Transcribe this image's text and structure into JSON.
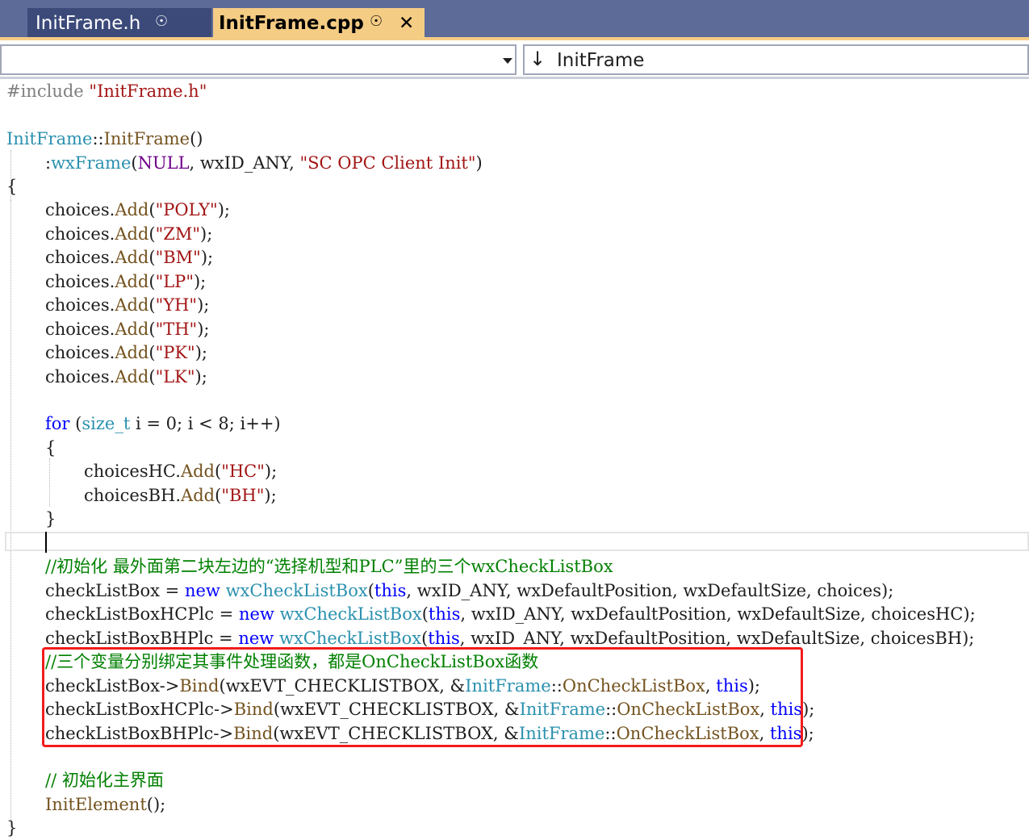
{
  "tabs": [
    {
      "label": "InitFrame.h",
      "pin": "☉"
    },
    {
      "label": "InitFrame.cpp",
      "pin": "☉",
      "close": "✕"
    }
  ],
  "icons": {
    "pin": "pin-icon",
    "close": "close-icon",
    "member": "down-arrow-icon"
  },
  "nav": {
    "member_arrow": "↓",
    "member": "InitFrame"
  },
  "code": {
    "include_kw": "#include",
    "include_file": "\"InitFrame.h\"",
    "class_name": "InitFrame",
    "scope": "::",
    "ctor_name": "InitFrame",
    "ctor_parens": "()",
    "init_colon": ":",
    "base_class": "wxFrame",
    "base_open": "(",
    "null_kw": "NULL",
    "comma": ",",
    "id_any": "wxID_ANY",
    "title_str": "\"SC OPC Client Init\"",
    "close_paren": ")",
    "open_brace": "{",
    "close_brace": "}",
    "choices_var": "choices",
    "dot": ".",
    "add_fn": "Add",
    "open_paren": "(",
    "close_semi": ");",
    "choice_values": [
      "\"POLY\"",
      "\"ZM\"",
      "\"BM\"",
      "\"LP\"",
      "\"YH\"",
      "\"TH\"",
      "\"PK\"",
      "\"LK\""
    ],
    "for_kw": "for",
    "size_t_type": "size_t",
    "for_tail": " i = 0; i < 8; i++)",
    "hc_var": "choicesHC",
    "hc_str": "\"HC\"",
    "bh_var": "choicesBH",
    "bh_str": "\"BH\"",
    "comment_init_boxes": "//初始化 最外面第二块左边的“选择机型和PLC”里的三个wxCheckListBox",
    "clb_var1": "checkListBox",
    "clb_var2": "checkListBoxHCPlc",
    "clb_var3": "checkListBoxBHPlc",
    "assign": " = ",
    "new_kw": "new",
    "clb_type": "wxCheckListBox",
    "this_kw": "this",
    "ctor_args_mid": ", wxID_ANY, wxDefaultPosition, wxDefaultSize, ",
    "args1": "choices",
    "args2": "choicesHC",
    "args3": "choicesBH",
    "comment_bind": "//三个变量分别绑定其事件处理函数，都是OnCheckListBox函数",
    "arrow": "->",
    "bind_fn": "Bind",
    "bind_args": "(wxEVT_CHECKLISTBOX, &",
    "handler": "OnCheckListBox",
    "comma_sp": ", ",
    "comment_main": "// 初始化主界面",
    "init_element": "InitElement",
    "call_end": "();"
  }
}
